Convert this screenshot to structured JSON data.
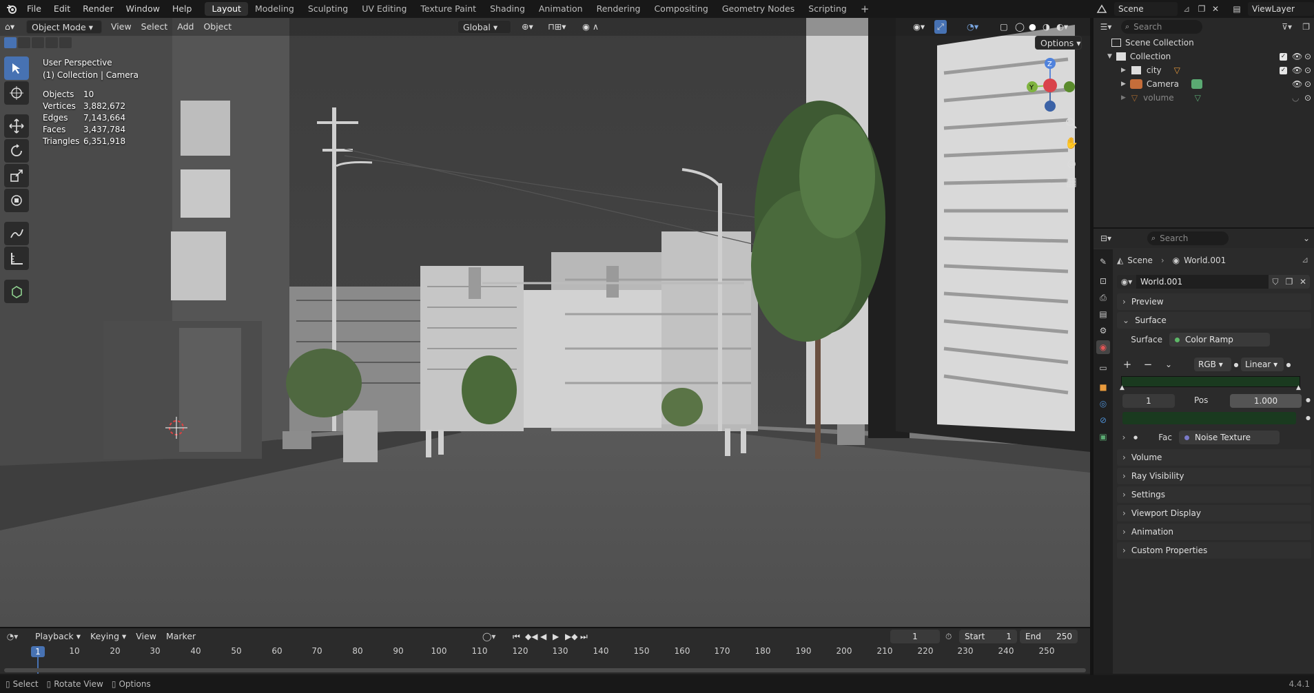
{
  "menu": {
    "items": [
      "File",
      "Edit",
      "Render",
      "Window",
      "Help"
    ],
    "workspaces": [
      "Layout",
      "Modeling",
      "Sculpting",
      "UV Editing",
      "Texture Paint",
      "Shading",
      "Animation",
      "Rendering",
      "Compositing",
      "Geometry Nodes",
      "Scripting"
    ],
    "active_workspace": "Layout",
    "add_tab": "+",
    "scene": "Scene",
    "view_layer": "ViewLayer"
  },
  "viewport": {
    "mode": "Object Mode",
    "menus": [
      "View",
      "Select",
      "Add",
      "Object"
    ],
    "transform_orientation": "Global",
    "options": "Options",
    "perspective": "User Perspective",
    "context": "(1) Collection | Camera",
    "stats": [
      {
        "label": "Objects",
        "value": "10"
      },
      {
        "label": "Vertices",
        "value": "3,882,672"
      },
      {
        "label": "Edges",
        "value": "7,143,664"
      },
      {
        "label": "Faces",
        "value": "3,437,784"
      },
      {
        "label": "Triangles",
        "value": "6,351,918"
      }
    ],
    "gizmo": {
      "z": "Z",
      "y": "Y"
    },
    "tools": [
      "select-box-icon",
      "cursor-icon",
      "move-icon",
      "rotate-icon",
      "scale-icon",
      "transform-icon",
      "annotate-icon",
      "measure-icon",
      "add-cube-icon"
    ]
  },
  "outliner": {
    "search_placeholder": "Search",
    "scene_collection": "Scene Collection",
    "items": [
      {
        "name": "Collection"
      },
      {
        "name": "city"
      },
      {
        "name": "Camera"
      },
      {
        "name": "volume"
      }
    ]
  },
  "properties": {
    "search_placeholder": "Search",
    "breadcrumb": [
      "Scene",
      "World.001"
    ],
    "world_name": "World.001",
    "panels": {
      "preview": "Preview",
      "surface": "Surface",
      "volume": "Volume",
      "ray_visibility": "Ray Visibility",
      "settings": "Settings",
      "viewport_display": "Viewport Display",
      "animation": "Animation",
      "custom_properties": "Custom Properties"
    },
    "surface_label": "Surface",
    "surface_value": "Color Ramp",
    "ramp_color_mode": "RGB",
    "ramp_interpolation": "Linear",
    "ramp_add": "+",
    "ramp_remove": "−",
    "stop_index": "1",
    "pos_label": "Pos",
    "pos_value": "1.000",
    "fac_label": "Fac",
    "fac_value": "Noise Texture",
    "ramp_color": "#1a3a1f"
  },
  "timeline": {
    "menus": [
      "Playback",
      "Keying",
      "View",
      "Marker"
    ],
    "current_frame": "1",
    "start_label": "Start",
    "start": "1",
    "end_label": "End",
    "end": "250",
    "ticks": [
      "10",
      "20",
      "30",
      "40",
      "50",
      "60",
      "70",
      "80",
      "90",
      "100",
      "110",
      "120",
      "130",
      "140",
      "150",
      "160",
      "170",
      "180",
      "190",
      "200",
      "210",
      "220",
      "230",
      "240",
      "250"
    ],
    "playhead": "1"
  },
  "statusbar": {
    "items": [
      "Select",
      "Rotate View",
      "Options"
    ],
    "version": "4.4.1"
  },
  "colors": {
    "accent": "#4772b3",
    "active_workspace": "#2f2f2f",
    "object_orange": "#e89a3c",
    "camera_green": "#5aa972"
  }
}
